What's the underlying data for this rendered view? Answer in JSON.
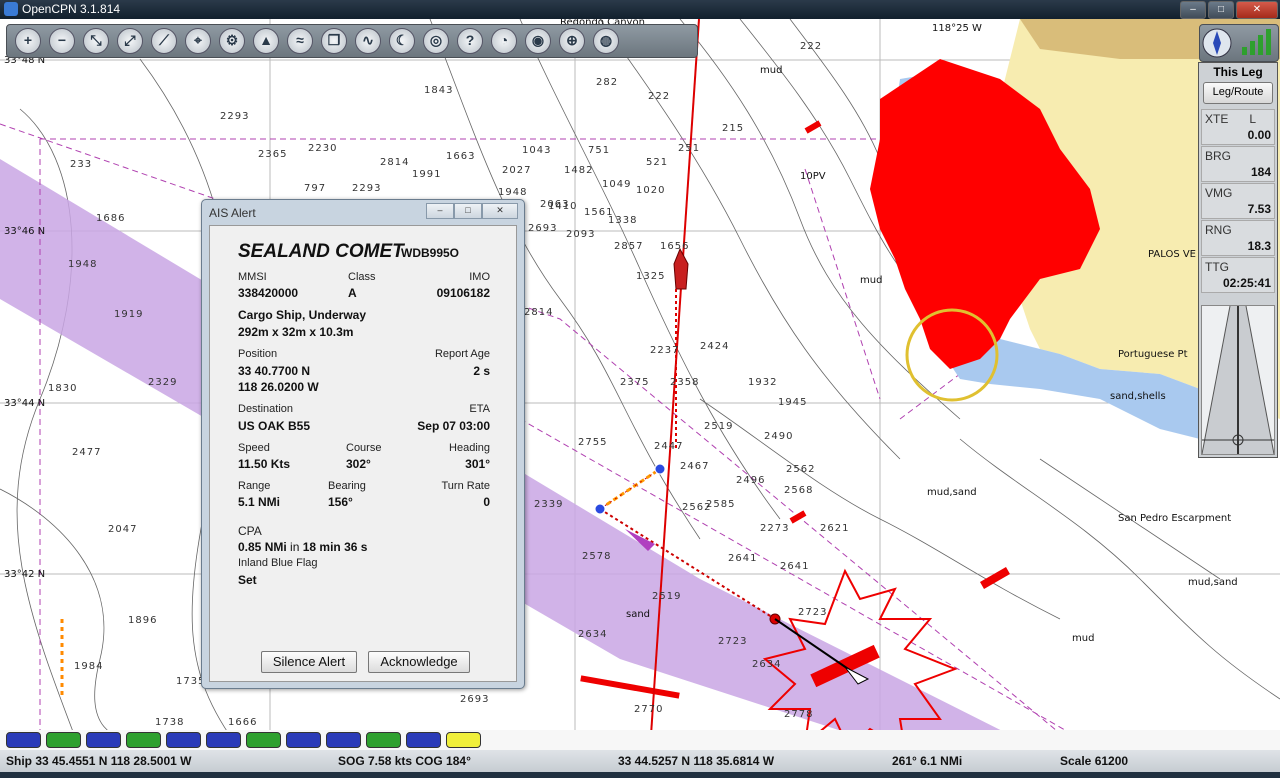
{
  "window": {
    "title": "OpenCPN 3.1.814",
    "buttons": [
      "–",
      "□",
      "✕"
    ]
  },
  "toolbar": {
    "icons": [
      "zoom-in-icon",
      "zoom-out-icon",
      "scale-in-icon",
      "scale-out-icon",
      "route-icon",
      "waypoint-icon",
      "settings-icon",
      "ais-icon",
      "track-icon",
      "copy-icon",
      "tide-icon",
      "moon-icon",
      "mob-icon",
      "help-icon",
      "gauge-icon",
      "radar-icon",
      "lifering-icon",
      "globe-icon"
    ]
  },
  "chart": {
    "latitudes": [
      "33°48 N",
      "33°46 N",
      "33°44 N",
      "33°42 N"
    ],
    "longitude_label": "118°25 W",
    "place_labels": [
      "PALOS VE",
      "Portuguese Pt",
      "San Pedro Escarpment",
      "sand",
      "mud,sand",
      "mud,sand",
      "sand,shells",
      "mud",
      "mud",
      "mud",
      "Redondo Canyon",
      "10PV"
    ],
    "depths": [
      "222",
      "282",
      "1843",
      "222",
      "215",
      "2293",
      "2365",
      "2230",
      "1663",
      "1043",
      "751",
      "521",
      "251",
      "233",
      "2814",
      "1991",
      "2027",
      "1482",
      "1049",
      "1020",
      "797",
      "2293",
      "1948",
      "2063",
      "1338",
      "1410",
      "1561",
      "1686",
      "2693",
      "2093",
      "1948",
      "2857",
      "1656",
      "1325",
      "1919",
      "2814",
      "2237",
      "2375",
      "2358",
      "2424",
      "1932",
      "1945",
      "1830",
      "2329",
      "2755",
      "2447",
      "2467",
      "2519",
      "2490",
      "2477",
      "2339",
      "2496",
      "2562",
      "2585",
      "2568",
      "2562",
      "2273",
      "2621",
      "2578",
      "2519",
      "2641",
      "2641",
      "2634",
      "2723",
      "2723",
      "1896",
      "1984",
      "2047",
      "1735",
      "1738",
      "1666",
      "2693",
      "2770",
      "2778",
      "2634"
    ]
  },
  "ais_alert": {
    "title": "AIS Alert",
    "ship_name": "SEALAND COMET",
    "callsign": "WDB995O",
    "mmsi_label": "MMSI",
    "mmsi": "338420000",
    "class_label": "Class",
    "class": "A",
    "imo_label": "IMO",
    "imo": "09106182",
    "type": "Cargo Ship, Underway",
    "dimensions": "292m x 32m x 10.3m",
    "position_label": "Position",
    "lat": "33 40.7700 N",
    "lon": "118 26.0200 W",
    "report_age_label": "Report Age",
    "report_age": "2 s",
    "destination_label": "Destination",
    "destination": "US OAK B55",
    "eta_label": "ETA",
    "eta": "Sep 07 03:00",
    "speed_label": "Speed",
    "speed": "11.50 Kts",
    "course_label": "Course",
    "course": "302°",
    "heading_label": "Heading",
    "heading": "301°",
    "range_label": "Range",
    "range": "5.1 NMi",
    "bearing_label": "Bearing",
    "bearing": "156°",
    "turn_rate_label": "Turn Rate",
    "turn_rate": "0",
    "cpa_label": "CPA",
    "cpa_dist": "0.85 NMi",
    "cpa_in": "in",
    "cpa_time": "18 min 36 s",
    "ibf_label": "Inland Blue Flag",
    "ibf": "Set",
    "silence_btn": "Silence Alert",
    "ack_btn": "Acknowledge"
  },
  "route_panel": {
    "header": "This Leg",
    "button": "Leg/Route",
    "xte_label": "XTE",
    "xte_unit": "L",
    "xte": "0.00",
    "brg_label": "BRG",
    "brg": "184",
    "vmg_label": "VMG",
    "vmg": "7.53",
    "rng_label": "RNG",
    "rng": "18.3",
    "ttg_label": "TTG",
    "ttg": "02:25:41"
  },
  "piano_colors": [
    "#2a3ab8",
    "#2ea02e",
    "#2a3ab8",
    "#2ea02e",
    "#2a3ab8",
    "#2a3ab8",
    "#2ea02e",
    "#2a3ab8",
    "#2a3ab8",
    "#2ea02e",
    "#2a3ab8",
    "#f0ef3a"
  ],
  "status": {
    "ship": "Ship 33 45.4551 N   118 28.5001 W",
    "sog": "SOG 7.58 kts  COG 184°",
    "cursor": "33 44.5257 N   118 35.6814 W",
    "brg_rng": "261°  6.1 NMi",
    "scale": "Scale 61200"
  }
}
